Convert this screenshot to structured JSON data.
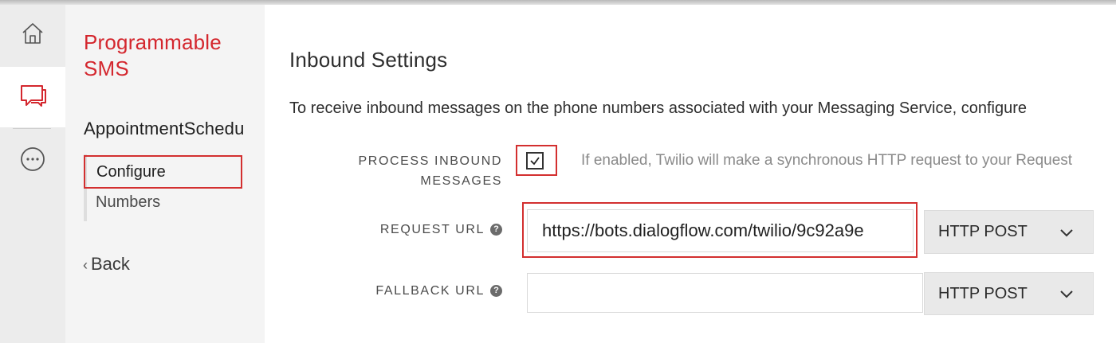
{
  "rail": {
    "items": [
      {
        "icon": "home-icon"
      },
      {
        "icon": "chat-icon",
        "active_color": "#d4272e"
      },
      {
        "icon": "more-icon"
      }
    ]
  },
  "sidebar": {
    "product_title": "Programmable SMS",
    "service_name": "AppointmentSchedu",
    "nav": [
      {
        "label": "Configure",
        "active": true
      },
      {
        "label": "Numbers"
      }
    ],
    "back_label": "Back"
  },
  "main": {
    "title": "Inbound Settings",
    "intro": "To receive inbound messages on the phone numbers associated with your Messaging Service, configure",
    "process_inbound": {
      "label": "PROCESS INBOUND MESSAGES",
      "checked": true,
      "hint": "If enabled, Twilio will make a synchronous HTTP request to your Request"
    },
    "request_url": {
      "label": "REQUEST URL",
      "value": "https://bots.dialogflow.com/twilio/9c92a9e",
      "method": "HTTP POST"
    },
    "fallback_url": {
      "label": "FALLBACK URL",
      "value": "",
      "method": "HTTP POST"
    }
  },
  "colors": {
    "brand_red": "#d4272e",
    "highlight_red": "#d32f2f"
  }
}
